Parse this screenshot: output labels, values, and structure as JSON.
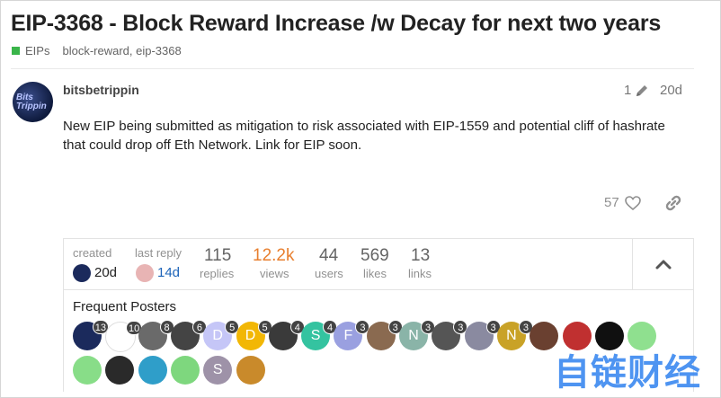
{
  "topic": {
    "title": "EIP-3368 - Block Reward Increase /w Decay for next two years",
    "category": "EIPs",
    "tags": "block-reward, eip-3368",
    "category_color": "#3ab54a"
  },
  "post": {
    "username": "bitsbetrippin",
    "avatar_text": "Bits Trippin",
    "edit_count": "1",
    "age": "20d",
    "body": "New EIP being submitted as mitigation to risk associated with EIP-1559 and potential cliff of hashrate that could drop off Eth Network. Link for EIP soon.",
    "like_count": "57"
  },
  "summary": {
    "created_label": "created",
    "created_value": "20d",
    "last_reply_label": "last reply",
    "last_reply_value": "14d",
    "stats": [
      {
        "value": "115",
        "label": "replies"
      },
      {
        "value": "12.2k",
        "label": "views"
      },
      {
        "value": "44",
        "label": "users"
      },
      {
        "value": "569",
        "label": "likes"
      },
      {
        "value": "13",
        "label": "links"
      }
    ],
    "frequent_posters_label": "Frequent Posters",
    "posters": [
      {
        "letter": "",
        "count": "13",
        "color": "#1b2a5c"
      },
      {
        "letter": "",
        "count": "10",
        "color": "#ffffff"
      },
      {
        "letter": "",
        "count": "8",
        "color": "#6a6a6a"
      },
      {
        "letter": "",
        "count": "6",
        "color": "#444444"
      },
      {
        "letter": "D",
        "count": "5",
        "color": "#c5c6f7"
      },
      {
        "letter": "D",
        "count": "5",
        "color": "#f2b705"
      },
      {
        "letter": "",
        "count": "4",
        "color": "#3a3a3a"
      },
      {
        "letter": "S",
        "count": "4",
        "color": "#34c3a0"
      },
      {
        "letter": "F",
        "count": "3",
        "color": "#9aa0e0"
      },
      {
        "letter": "",
        "count": "3",
        "color": "#8a6a50"
      },
      {
        "letter": "N",
        "count": "3",
        "color": "#8ab4a8"
      },
      {
        "letter": "",
        "count": "3",
        "color": "#555555"
      },
      {
        "letter": "",
        "count": "3",
        "color": "#8a8aa0"
      },
      {
        "letter": "N",
        "count": "3",
        "color": "#c9a227"
      },
      {
        "letter": "",
        "count": "",
        "color": "#6a4030"
      },
      {
        "letter": "",
        "count": "",
        "color": "#c03030"
      },
      {
        "letter": "",
        "count": "",
        "color": "#101010"
      },
      {
        "letter": "",
        "count": "",
        "color": "#8fe08f"
      },
      {
        "letter": "",
        "count": "",
        "color": "#88dd88"
      },
      {
        "letter": "",
        "count": "",
        "color": "#2a2a2a"
      },
      {
        "letter": "",
        "count": "",
        "color": "#2f9ec9"
      },
      {
        "letter": "",
        "count": "",
        "color": "#7ed77e"
      },
      {
        "letter": "S",
        "count": "",
        "color": "#9e92a8"
      },
      {
        "letter": "",
        "count": "",
        "color": "#c98a2b"
      }
    ]
  },
  "watermark": "自链财经",
  "icons": {
    "edit": "pencil-icon",
    "like": "heart-icon",
    "share": "link-icon",
    "collapse": "chevron-up-icon"
  }
}
